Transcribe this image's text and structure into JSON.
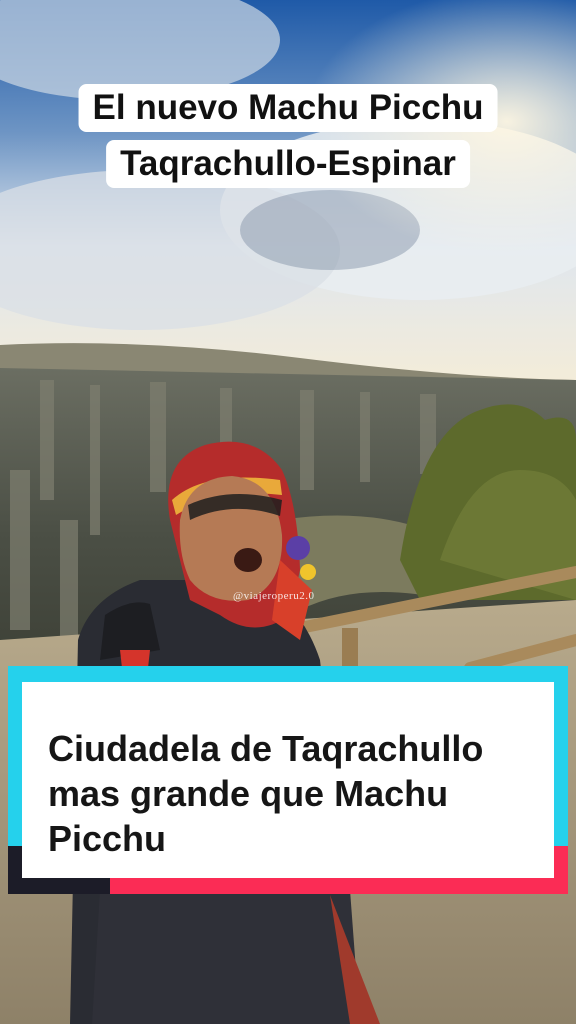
{
  "overlay": {
    "title_line_1": "El nuevo Machu Picchu",
    "title_line_2": "Taqrachullo-Espinar",
    "watermark": "@viajeroperu2.0",
    "caption": "Ciudadela de Taqrachullo mas grande que Machu Picchu"
  },
  "colors": {
    "caption_accent_cyan": "#25d1ec",
    "caption_accent_red": "#fb2c55",
    "caption_accent_dark": "#1c1c28"
  }
}
